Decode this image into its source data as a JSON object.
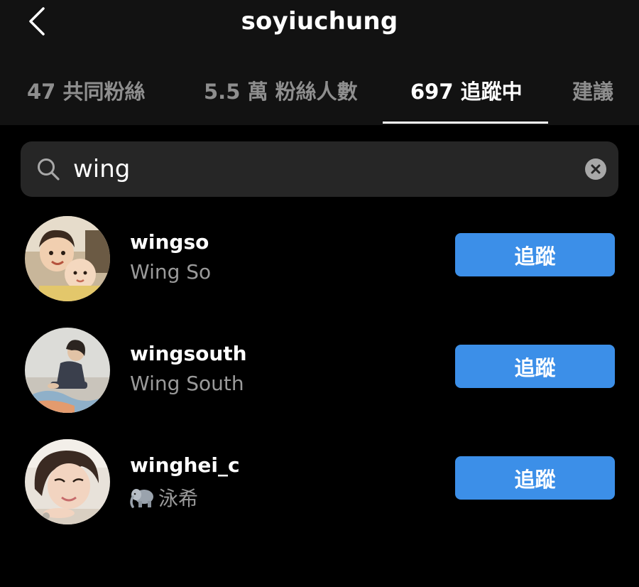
{
  "header": {
    "title": "soyiuchung",
    "back_icon": "chevron-left-icon"
  },
  "tabs": [
    {
      "label": "47 共同粉絲",
      "active": false
    },
    {
      "label": "5.5 萬 粉絲人數",
      "active": false
    },
    {
      "label": "697 追蹤中",
      "active": true
    },
    {
      "label": "建議",
      "active": false
    }
  ],
  "search": {
    "value": "wing",
    "icon": "search-icon",
    "clear_icon": "clear-icon"
  },
  "results": [
    {
      "username": "wingso",
      "full_name": "Wing So",
      "button_label": "追蹤"
    },
    {
      "username": "wingsouth",
      "full_name": "Wing South",
      "button_label": "追蹤"
    },
    {
      "username": "winghei_c",
      "full_name": "泳希",
      "name_emoji": "elephant-emoji",
      "button_label": "追蹤"
    }
  ],
  "colors": {
    "background": "#000000",
    "header_background": "#121212",
    "search_background": "#262626",
    "follow_button": "#3c8fe8",
    "secondary_text": "#9a9a9a"
  }
}
